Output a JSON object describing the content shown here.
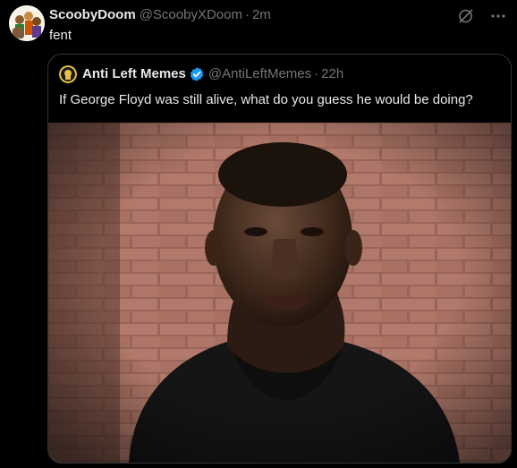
{
  "tweet": {
    "display_name": "ScoobyDoom",
    "handle": "@ScoobyXDoom",
    "separator": "·",
    "time": "2m",
    "text": "fent",
    "avatar_icon": "scooby-gang-avatar-icon"
  },
  "actions": {
    "grok_icon": "grok-slash-icon",
    "more_icon": "more-dots-icon"
  },
  "quoted": {
    "display_name": "Anti Left Memes",
    "handle": "@AntiLeftMemes",
    "separator": "·",
    "time": "22h",
    "text": "If George Floyd was still alive, what do you guess he would be doing?",
    "verified_icon": "verified-badge-icon",
    "verified_color": "#1d9bf0"
  },
  "colors": {
    "background": "#000000",
    "text": "#e7e9ea",
    "muted": "#71767b",
    "border": "#2f3336"
  }
}
